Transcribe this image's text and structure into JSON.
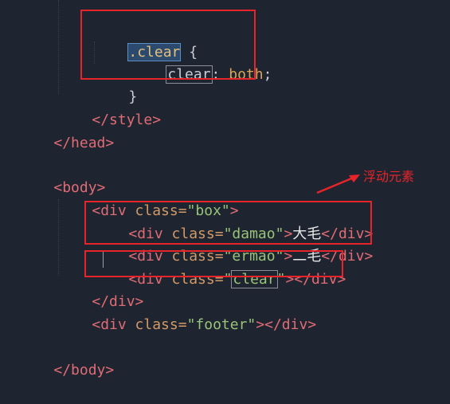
{
  "code": {
    "l1_selector": ".clear",
    "l1_brace": " {",
    "l2_prop": "clear",
    "l2_colon": ": ",
    "l2_value": "both",
    "l2_semicolon": ";",
    "l3_close": "}",
    "l4": "</style>",
    "l5": "</head>",
    "l6": "<body>",
    "l7_open": "<div ",
    "l7_attr": "class=",
    "l7_val": "\"box\"",
    "l7_end": ">",
    "l8_open": "<div ",
    "l8_attr": "class=",
    "l8_val": "\"damao\"",
    "l8_gt": ">",
    "l8_text": "大毛",
    "l8_close": "</div>",
    "l9_open": "<div ",
    "l9_attr": "class=",
    "l9_val": "\"ermao\"",
    "l9_gt": ">",
    "l9_text": "二毛",
    "l9_close": "</div>",
    "l10_open": "<div ",
    "l10_attr": "class=",
    "l10_q1": "\"",
    "l10_word": "clear",
    "l10_q2": "\"",
    "l10_end": "></div>",
    "l11": "</div>",
    "l12_open": "<div ",
    "l12_attr": "class=",
    "l12_val": "\"footer\"",
    "l12_end": "></div>",
    "l13": "</body>"
  },
  "annotation": {
    "text": "浮动元素"
  },
  "colors": {
    "background": "#1e2430",
    "annotation": "#e8242b",
    "tag": "#e06c75",
    "string": "#98c379",
    "selector": "#e5c07b"
  }
}
